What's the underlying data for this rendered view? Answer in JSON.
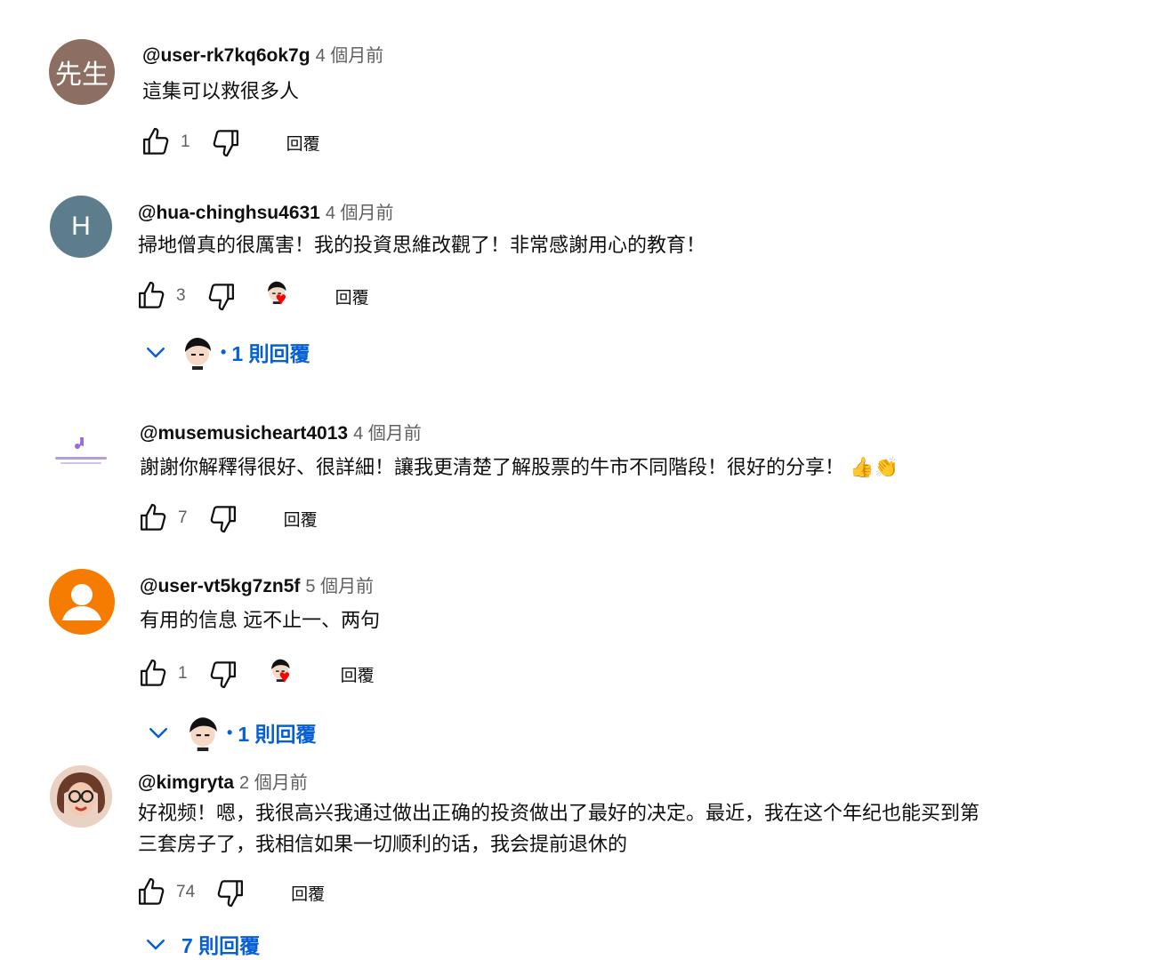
{
  "comments": [
    {
      "handle": "@user-rk7kq6ok7g",
      "time": "4 個月前",
      "avatar_text": "先生",
      "avatar_color": "#8d6e63",
      "text": "這集可以救很多人",
      "likes": "1",
      "reply_label": "回覆"
    },
    {
      "handle": "@hua-chinghsu4631",
      "time": "4 個月前",
      "avatar_text": "H",
      "avatar_color": "#5e7d8c",
      "text": "掃地僧真的很厲害！我的投資思維改觀了！非常感謝用心的教育！",
      "likes": "3",
      "reply_label": "回覆",
      "replies_label": "1 則回覆"
    },
    {
      "handle": "@musemusicheart4013",
      "time": "4 個月前",
      "text": "謝謝你解釋得很好、很詳細！讓我更清楚了解股票的牛市不同階段！很好的分享！",
      "emoji": "👍👏",
      "likes": "7",
      "reply_label": "回覆"
    },
    {
      "handle": "@user-vt5kg7zn5f",
      "time": "5 個月前",
      "avatar_color": "#f57c00",
      "text": "有用的信息 远不止一、两句",
      "likes": "1",
      "reply_label": "回覆",
      "replies_label": "1 則回覆"
    },
    {
      "handle": "@kimgryta",
      "time": "2 個月前",
      "text_line1": "好视频！嗯，我很高兴我通过做出正确的投资做出了最好的决定。最近，我在这个年纪也能买到第",
      "text_line2": "三套房子了，我相信如果一切顺利的话，我会提前退休的",
      "likes": "74",
      "reply_label": "回覆",
      "replies_label": "7 則回覆"
    }
  ],
  "colors": {
    "link_blue": "#065fd4",
    "heart_red": "#ff0000",
    "secondary_text": "#606060"
  }
}
